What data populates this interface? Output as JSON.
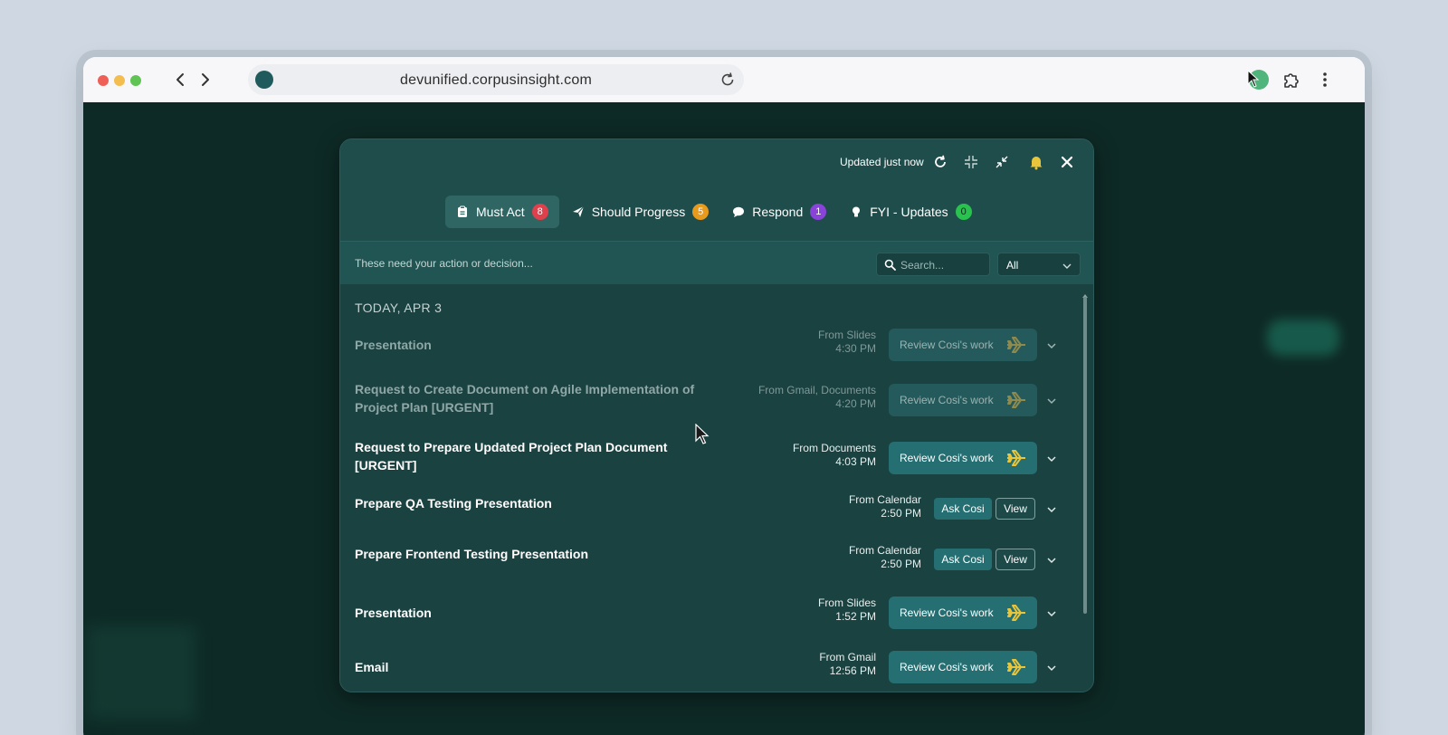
{
  "browser": {
    "url": "devunified.corpusinsight.com"
  },
  "panel": {
    "updated_text": "Updated just now",
    "tabs": [
      {
        "label": "Must Act",
        "count": "8",
        "color": "#e0404c",
        "icon": "clipboard-icon"
      },
      {
        "label": "Should Progress",
        "count": "5",
        "color": "#e89a1c",
        "icon": "paper-plane-icon"
      },
      {
        "label": "Respond",
        "count": "1",
        "color": "#8a43d8",
        "icon": "chat-bubble-icon"
      },
      {
        "label": "FYI - Updates",
        "count": "0",
        "color": "#29c24e",
        "icon": "lightbulb-icon"
      }
    ],
    "hint": "These need your action or decision...",
    "search_placeholder": "Search...",
    "filter_value": "All",
    "date_heading": "TODAY, APR 3",
    "items": [
      {
        "title": "Presentation",
        "source": "From Slides",
        "time": "4:30 PM",
        "action": "Review Cosi's work",
        "state": "dim"
      },
      {
        "title": "Request to Create Document on Agile Implementation of Project Plan [URGENT]",
        "source": "From Gmail, Documents",
        "time": "4:20 PM",
        "action": "Review Cosi's work",
        "state": "dim"
      },
      {
        "title": "Request to Prepare Updated Project Plan Document [URGENT]",
        "source": "From Documents",
        "time": "4:03 PM",
        "action": "Review Cosi's work",
        "state": "normal"
      },
      {
        "title": "Prepare QA Testing Presentation",
        "source": "From Calendar",
        "time": "2:50 PM",
        "ask_label": "Ask Cosi",
        "view_label": "View",
        "state": "normal"
      },
      {
        "title": "Prepare Frontend Testing Presentation",
        "source": "From Calendar",
        "time": "2:50 PM",
        "ask_label": "Ask Cosi",
        "view_label": "View",
        "state": "normal"
      },
      {
        "title": "Presentation",
        "source": "From Slides",
        "time": "1:52 PM",
        "action": "Review Cosi's work",
        "state": "normal"
      },
      {
        "title": "Email",
        "source": "From Gmail",
        "time": "12:56 PM",
        "action": "Review Cosi's work",
        "state": "normal"
      }
    ]
  },
  "colors": {
    "accent_yellow": "#e8c53a",
    "panel_bg": "#1d4948",
    "button_teal": "#256f72"
  }
}
